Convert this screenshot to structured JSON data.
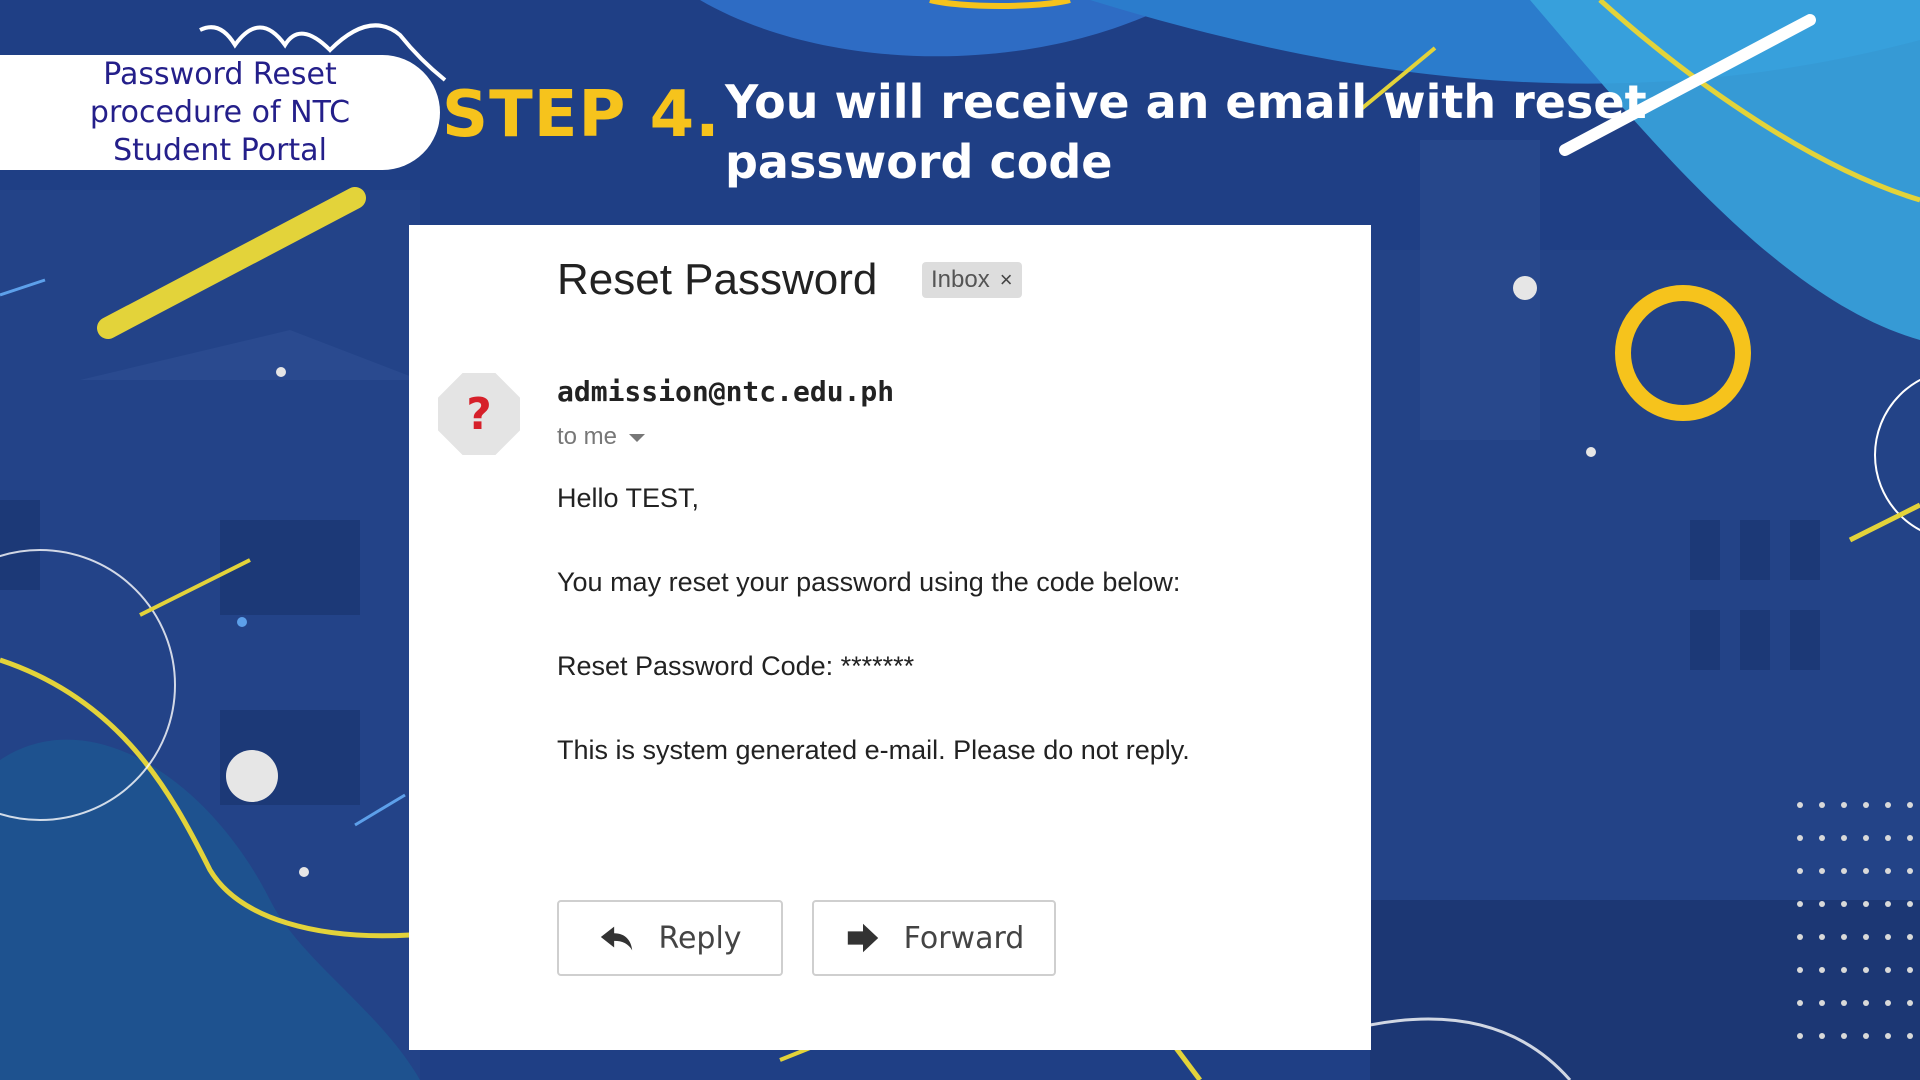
{
  "slide": {
    "badge_lines": [
      "Password Reset",
      "procedure of NTC",
      "Student Portal"
    ],
    "step_label": "STEP 4.",
    "step_text": "You will receive an email with reset password code"
  },
  "email": {
    "subject": "Reset Password",
    "label_tag": "Inbox",
    "label_close": "×",
    "avatar_glyph": "?",
    "sender": "admission@ntc.edu.ph",
    "recipient": "to me",
    "body": [
      "Hello TEST,",
      "You may reset your password using the code below:",
      "Reset Password Code: *******",
      "This is system generated e-mail. Please do not reply."
    ],
    "actions": {
      "reply_label": "Reply",
      "reply_icon": "reply-arrow-icon",
      "forward_label": "Forward",
      "forward_icon": "forward-arrow-icon"
    }
  },
  "colors": {
    "background_blue": "#1d3f86",
    "accent_yellow": "#f6c31c",
    "badge_text": "#241f8a",
    "avatar_red": "#d6202a"
  }
}
